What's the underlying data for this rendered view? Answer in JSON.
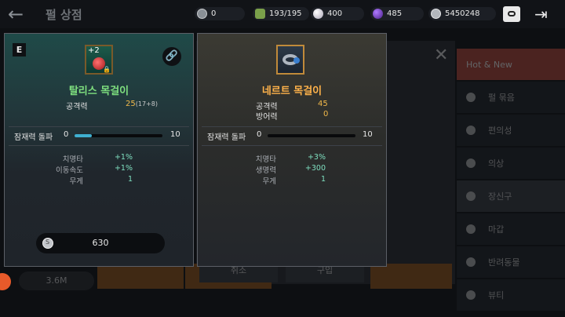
{
  "header": {
    "title": "펄 상점",
    "currencies": [
      {
        "icon": "silver-coin-outline-icon",
        "value": "0"
      },
      {
        "icon": "stamina-icon",
        "value": "193/195"
      },
      {
        "icon": "pearl-icon",
        "value": "400"
      },
      {
        "icon": "purple-orb-icon",
        "value": "485"
      },
      {
        "icon": "silver-coin-icon",
        "value": "5450248"
      }
    ]
  },
  "background": {
    "sidebar": [
      "Hot & New",
      "펄 묶음",
      "편의성",
      "의상",
      "장신구",
      "마갑",
      "반려동물",
      "뷰티"
    ],
    "buttons": [
      "취소",
      "구입"
    ],
    "price": "3.6M"
  },
  "left_item": {
    "badge": "E",
    "enhance": "+2",
    "name": "탈리스 목걸이",
    "stats": [
      {
        "label": "공격력",
        "value": "25",
        "detail": "(17+8)"
      }
    ],
    "potential": {
      "label": "잠재력 돌파",
      "min": "0",
      "max": "10",
      "current": 2
    },
    "sub_stats": [
      {
        "label": "치명타",
        "value": "+1%"
      },
      {
        "label": "이동속도",
        "value": "+1%"
      },
      {
        "label": "무게",
        "value": "1"
      }
    ],
    "price": "630"
  },
  "right_item": {
    "name": "네르트 목걸이",
    "stats": [
      {
        "label": "공격력",
        "value": "45"
      },
      {
        "label": "방어력",
        "value": "0"
      }
    ],
    "potential": {
      "label": "잠재력 돌파",
      "min": "0",
      "max": "10",
      "current": 0
    },
    "sub_stats": [
      {
        "label": "치명타",
        "value": "+3%"
      },
      {
        "label": "생명력",
        "value": "+300"
      },
      {
        "label": "무게",
        "value": "1"
      }
    ]
  }
}
